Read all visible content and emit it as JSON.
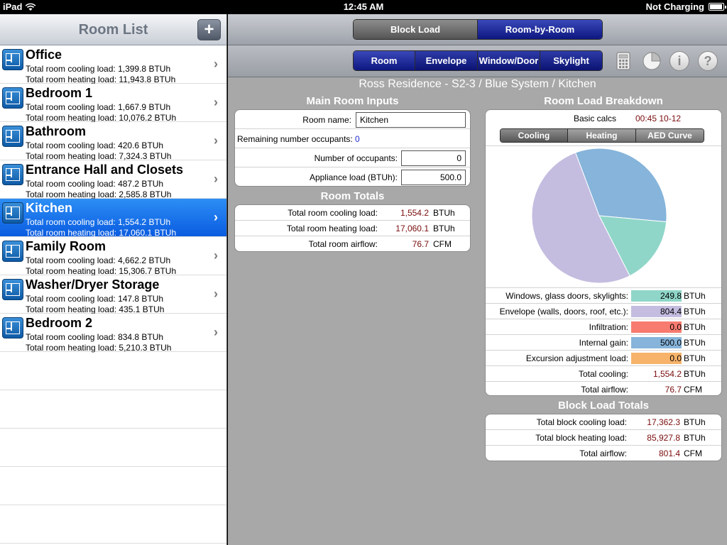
{
  "status": {
    "device": "iPad",
    "time": "12:45 AM",
    "charging": "Not Charging"
  },
  "sidebar": {
    "title": "Room List",
    "add_label": "+",
    "rooms": [
      {
        "name": "Office",
        "cooling": "Total room cooling load: 1,399.8 BTUh",
        "heating": "Total room heating load: 11,943.8 BTUh"
      },
      {
        "name": "Bedroom 1",
        "cooling": "Total room cooling load: 1,667.9 BTUh",
        "heating": "Total room heating load: 10,076.2 BTUh"
      },
      {
        "name": "Bathroom",
        "cooling": "Total room cooling load: 420.6 BTUh",
        "heating": "Total room heating load: 7,324.3 BTUh"
      },
      {
        "name": "Entrance Hall and Closets",
        "cooling": "Total room cooling load: 487.2 BTUh",
        "heating": "Total room heating load: 2,585.8 BTUh"
      },
      {
        "name": "Kitchen",
        "cooling": "Total room cooling load: 1,554.2 BTUh",
        "heating": "Total room heating load: 17,060.1 BTUh",
        "selected": true
      },
      {
        "name": "Family Room",
        "cooling": "Total room cooling load: 4,662.2 BTUh",
        "heating": "Total room heating load: 15,306.7 BTUh"
      },
      {
        "name": "Washer/Dryer Storage",
        "cooling": "Total room cooling load: 147.8 BTUh",
        "heating": "Total room heating load: 435.1 BTUh"
      },
      {
        "name": "Bedroom 2",
        "cooling": "Total room cooling load: 834.8 BTUh",
        "heating": "Total room heating load: 5,210.3 BTUh"
      }
    ],
    "chevron": "›"
  },
  "topbar": {
    "block_load": "Block Load",
    "room_by_room": "Room-by-Room"
  },
  "tabs": {
    "room": "Room",
    "envelope": "Envelope",
    "window_door": "Window/Door",
    "skylight": "Skylight"
  },
  "page_title": "Ross Residence - S2-3 / Blue System / Kitchen",
  "main_inputs": {
    "title": "Main Room Inputs",
    "room_name_label": "Room name:",
    "room_name_value": "Kitchen",
    "remaining_label": "Remaining number occupants:",
    "remaining_value": "0",
    "occupants_label": "Number of occupants:",
    "occupants_value": "0",
    "appliance_label": "Appliance load (BTUh):",
    "appliance_value": "500.0"
  },
  "room_totals": {
    "title": "Room Totals",
    "rows": [
      {
        "label": "Total room cooling load:",
        "value": "1,554.2",
        "unit": "BTUh"
      },
      {
        "label": "Total room heating load:",
        "value": "17,060.1",
        "unit": "BTUh"
      },
      {
        "label": "Total room airflow:",
        "value": "76.7",
        "unit": "CFM"
      }
    ]
  },
  "breakdown": {
    "title": "Room Load Breakdown",
    "basic_calcs_label": "Basic calcs",
    "basic_calcs_value": "00:45 10-12",
    "tabs": {
      "cooling": "Cooling",
      "heating": "Heating",
      "aed": "AED Curve"
    },
    "rows": [
      {
        "label": "Windows, glass doors, skylights:",
        "value": "249.8",
        "unit": "BTUh",
        "color": "#8fd6c8"
      },
      {
        "label": "Envelope (walls, doors, roof, etc.):",
        "value": "804.4",
        "unit": "BTUh",
        "color": "#c4bde0"
      },
      {
        "label": "Infiltration:",
        "value": "0.0",
        "unit": "BTUh",
        "color": "#f77b6f"
      },
      {
        "label": "Internal gain:",
        "value": "500.0",
        "unit": "BTUh",
        "color": "#86b4da"
      },
      {
        "label": "Excursion adjustment load:",
        "value": "0.0",
        "unit": "BTUh",
        "color": "#f7b36a"
      },
      {
        "label": "Total cooling:",
        "value": "1,554.2",
        "unit": "BTUh"
      },
      {
        "label": "Total airflow:",
        "value": "76.7",
        "unit": "CFM"
      }
    ]
  },
  "chart_data": {
    "type": "pie",
    "categories": [
      "Windows, glass doors, skylights",
      "Envelope (walls, doors, roof, etc.)",
      "Infiltration",
      "Internal gain",
      "Excursion adjustment load"
    ],
    "values": [
      249.8,
      804.4,
      0.0,
      500.0,
      0.0
    ],
    "colors": [
      "#8fd6c8",
      "#c4bde0",
      "#f77b6f",
      "#86b4da",
      "#f7b36a"
    ],
    "title": ""
  },
  "block_totals": {
    "title": "Block Load Totals",
    "rows": [
      {
        "label": "Total block cooling load:",
        "value": "17,362.3",
        "unit": "BTUh"
      },
      {
        "label": "Total block heating load:",
        "value": "85,927.8",
        "unit": "BTUh"
      },
      {
        "label": "Total airflow:",
        "value": "801.4",
        "unit": "CFM"
      }
    ]
  },
  "icons": {
    "calculator": "calculator-icon",
    "pie": "pie-chart-icon",
    "info": "i",
    "help": "?"
  }
}
